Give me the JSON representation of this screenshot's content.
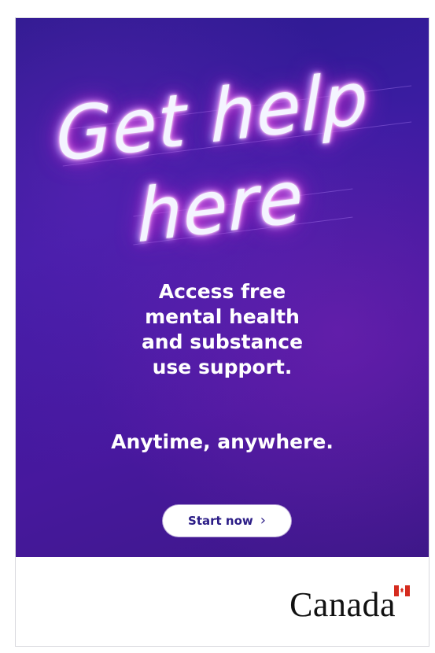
{
  "ad": {
    "headline_line1": "Get help",
    "headline_line2": "here",
    "body_lines": [
      "Access free",
      "mental health",
      "and substance",
      "use support."
    ],
    "tagline": "Anytime, anywhere.",
    "cta_label": "Start now",
    "cta_icon": "chevron-right-icon",
    "cta_chevron": "›",
    "footer_wordmark": "Canada",
    "flag_icon": "canada-flag-icon"
  },
  "colors": {
    "panel_top": "#281a8a",
    "panel_bottom": "#47189e",
    "neon_pink": "#f33ad8",
    "neon_cyan": "#3fd1ff",
    "cta_text": "#2b1c86",
    "flag_red": "#d52b1e"
  }
}
